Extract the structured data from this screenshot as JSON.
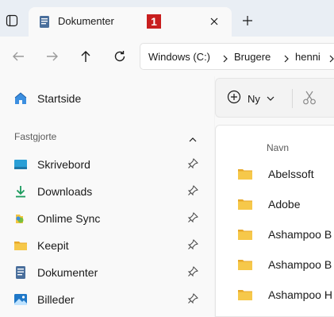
{
  "tabs": [
    {
      "label": "Dokumenter",
      "badge": "1",
      "icon": "documents-icon"
    }
  ],
  "address": {
    "crumbs": [
      "Windows (C:)",
      "Brugere",
      "henni"
    ]
  },
  "sidebar": {
    "home": {
      "label": "Startside",
      "icon": "home-icon"
    },
    "pinned_title": "Fastgjorte",
    "items": [
      {
        "label": "Skrivebord",
        "icon": "desktop-icon"
      },
      {
        "label": "Downloads",
        "icon": "download-icon"
      },
      {
        "label": "Onlime Sync",
        "icon": "sync-folder-icon"
      },
      {
        "label": "Keepit",
        "icon": "folder-icon"
      },
      {
        "label": "Dokumenter",
        "icon": "documents-icon"
      },
      {
        "label": "Billeder",
        "icon": "pictures-icon"
      }
    ]
  },
  "toolbar": {
    "new_label": "Ny"
  },
  "file_list": {
    "column_name": "Navn",
    "rows": [
      "Abelssoft",
      "Adobe",
      "Ashampoo B",
      "Ashampoo B",
      "Ashampoo H"
    ]
  },
  "colors": {
    "accent": "#0067c0",
    "folder": "#f4c542",
    "badge": "#c81e1e"
  }
}
